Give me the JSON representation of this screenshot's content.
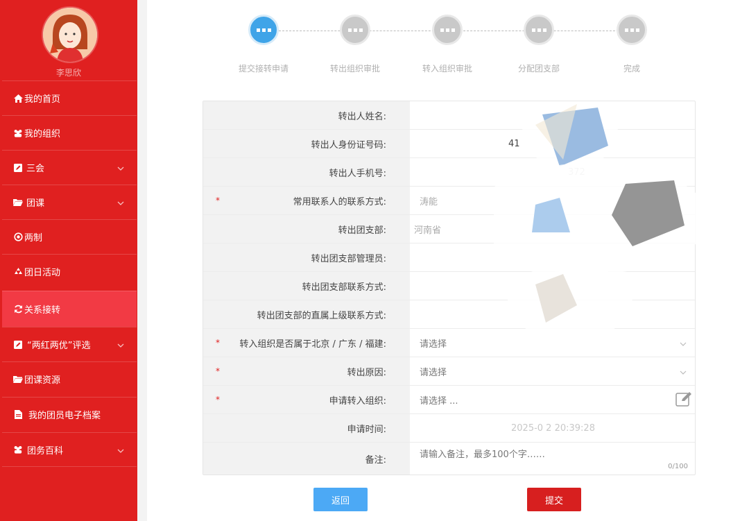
{
  "user": {
    "name": "李思欣"
  },
  "menu": [
    {
      "label": "我的首页",
      "icon": "home-icon",
      "has_sub": false
    },
    {
      "label": "我的组织",
      "icon": "users-icon",
      "has_sub": false
    },
    {
      "label": "三会",
      "icon": "edit-icon",
      "has_sub": true
    },
    {
      "label": "团课",
      "icon": "folder-icon",
      "has_sub": true
    },
    {
      "label": "两制",
      "icon": "target-icon",
      "has_sub": false
    },
    {
      "label": "团日活动",
      "icon": "recycle-icon",
      "has_sub": false
    },
    {
      "label": "关系接转",
      "icon": "refresh-icon",
      "has_sub": false,
      "active": true
    },
    {
      "label": "“两红两优”评选",
      "icon": "edit-icon",
      "has_sub": true
    },
    {
      "label": "团课资源",
      "icon": "folder-icon",
      "has_sub": false
    },
    {
      "label": "我的团员电子档案",
      "icon": "file-icon",
      "has_sub": false
    },
    {
      "label": "团务百科",
      "icon": "users-icon",
      "has_sub": true
    }
  ],
  "steps": [
    {
      "label": "提交接转申请",
      "active": true
    },
    {
      "label": "转出组织审批",
      "active": false
    },
    {
      "label": "转入组织审批",
      "active": false
    },
    {
      "label": "分配团支部",
      "active": false
    },
    {
      "label": "完成",
      "active": false
    }
  ],
  "form": {
    "rows": [
      {
        "label": "转出人姓名:",
        "required": false,
        "value": ""
      },
      {
        "label": "转出人身份证号码:",
        "required": false,
        "value": "41"
      },
      {
        "label": "转出人手机号:",
        "required": false,
        "value": "372"
      },
      {
        "label": "常用联系人的联系方式:",
        "required": true,
        "value": "涛能"
      },
      {
        "label": "转出团支部:",
        "required": false,
        "value": "河南省"
      },
      {
        "label": "转出团支部管理员:",
        "required": false,
        "value": ""
      },
      {
        "label": "转出团支部联系方式:",
        "required": false,
        "value": ""
      },
      {
        "label": "转出团支部的直属上级联系方式:",
        "required": false,
        "value": ""
      },
      {
        "label": "转入组织是否属于北京 / 广东 / 福建:",
        "required": true,
        "placeholder": "请选择",
        "type": "select"
      },
      {
        "label": "转出原因:",
        "required": true,
        "placeholder": "请选择",
        "type": "select"
      },
      {
        "label": "申请转入组织:",
        "required": true,
        "placeholder": "请选择 ...",
        "type": "picker"
      },
      {
        "label": "申请时间:",
        "required": false,
        "value": "2025-0 2 20:39:28"
      },
      {
        "label": "备注:",
        "required": false,
        "placeholder": "请输入备注，最多100个字……",
        "type": "textarea",
        "counter": "0/100"
      }
    ],
    "required_mark": "*"
  },
  "buttons": {
    "back": "返回",
    "submit": "提交"
  },
  "colors": {
    "sidebar": "#e02020",
    "active_menu": "#f23a44",
    "step_active": "#3fa4e8",
    "back_button": "#4ca9f5",
    "submit_button": "#d71f1f"
  }
}
